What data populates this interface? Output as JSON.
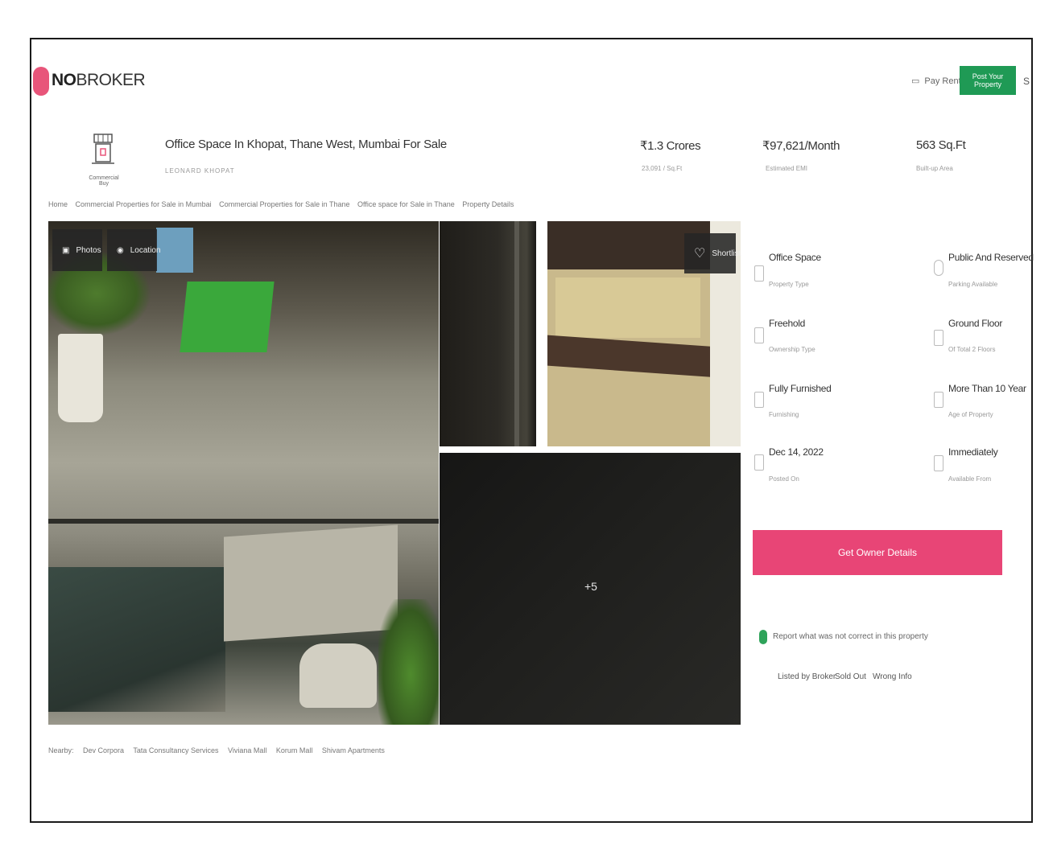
{
  "header": {
    "logo_bold": "NO",
    "logo_light": "BROKER",
    "pay_rent": "Pay Rent",
    "post_property": "Post Your Property",
    "menu_edge": "S"
  },
  "property": {
    "icon_label": "Commercial Buy",
    "title": "Office Space In Khopat, Thane West, Mumbai For Sale",
    "subtitle": "LEONARD KHOPAT",
    "price": "₹1.3 Crores",
    "price_label": "23,091 / Sq.Ft",
    "emi": "₹97,621/Month",
    "emi_label": "Estimated EMI",
    "area": "563 Sq.Ft",
    "area_label": "Built-up Area"
  },
  "breadcrumb": [
    "Home",
    "Commercial Properties for Sale in Mumbai",
    "Commercial Properties for Sale in Thane",
    "Office space for Sale in Thane",
    "Property Details"
  ],
  "gallery": {
    "photos_label": "Photos",
    "location_label": "Location",
    "shortlist_label": "Shortlist",
    "more_count": "+5"
  },
  "details": [
    {
      "value": "Office Space",
      "label": "Property Type"
    },
    {
      "value": "Public And Reserved",
      "label": "Parking Available"
    },
    {
      "value": "Freehold",
      "label": "Ownership Type"
    },
    {
      "value": "Ground Floor",
      "label": "Of Total 2 Floors"
    },
    {
      "value": "Fully Furnished",
      "label": "Furnishing"
    },
    {
      "value": "More Than 10 Year",
      "label": "Age of Property"
    },
    {
      "value": "Dec 14, 2022",
      "label": "Posted On"
    },
    {
      "value": "Immediately",
      "label": "Available From"
    }
  ],
  "owner_button": "Get Owner Details",
  "report": {
    "text": "Report what was not correct in this property",
    "options": [
      "Listed by Broker",
      "Sold Out",
      "Wrong Info"
    ]
  },
  "nearby": [
    "Nearby:",
    "Dev Corpora",
    "Tata Consultancy Services",
    "Viviana Mall",
    "Korum Mall",
    "Shivam Apartments"
  ]
}
